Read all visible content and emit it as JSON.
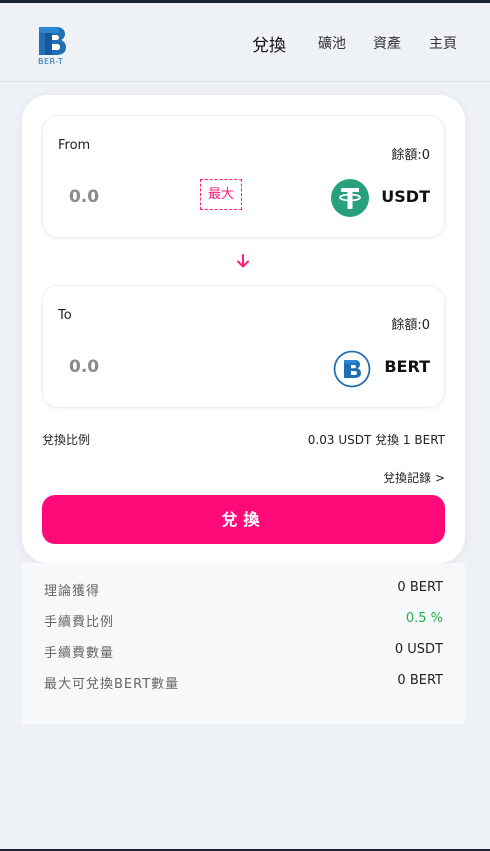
{
  "header": {
    "logo_text": "BER-T",
    "nav": [
      "兌換",
      "礦池",
      "資產",
      "主頁"
    ]
  },
  "from": {
    "label": "From",
    "balance": "餘額:0",
    "amount_placeholder": "0.0",
    "max_label": "最大",
    "token": "USDT",
    "token_icon": "tether-icon"
  },
  "to": {
    "label": "To",
    "balance": "餘額:0",
    "amount_placeholder": "0.0",
    "token": "BERT",
    "token_icon": "bert-icon"
  },
  "rate": {
    "label": "兌換比例",
    "value": "0.03 USDT 兌換 1 BERT"
  },
  "history_link": "兌換記錄 >",
  "swap_button": "兌換",
  "info": [
    {
      "label": "理論獲得",
      "value": "0 BERT"
    },
    {
      "label": "手續費比例",
      "value": "0.5 %"
    },
    {
      "label": "手續費數量",
      "value": "0 USDT"
    },
    {
      "label": "最大可兌換BERT數量",
      "value": "0 BERT"
    }
  ],
  "colors": {
    "accent": "#ff0a78",
    "tether": "#26a17b",
    "bert": "#1f6fb2",
    "fee_rate": "#22b14c"
  }
}
